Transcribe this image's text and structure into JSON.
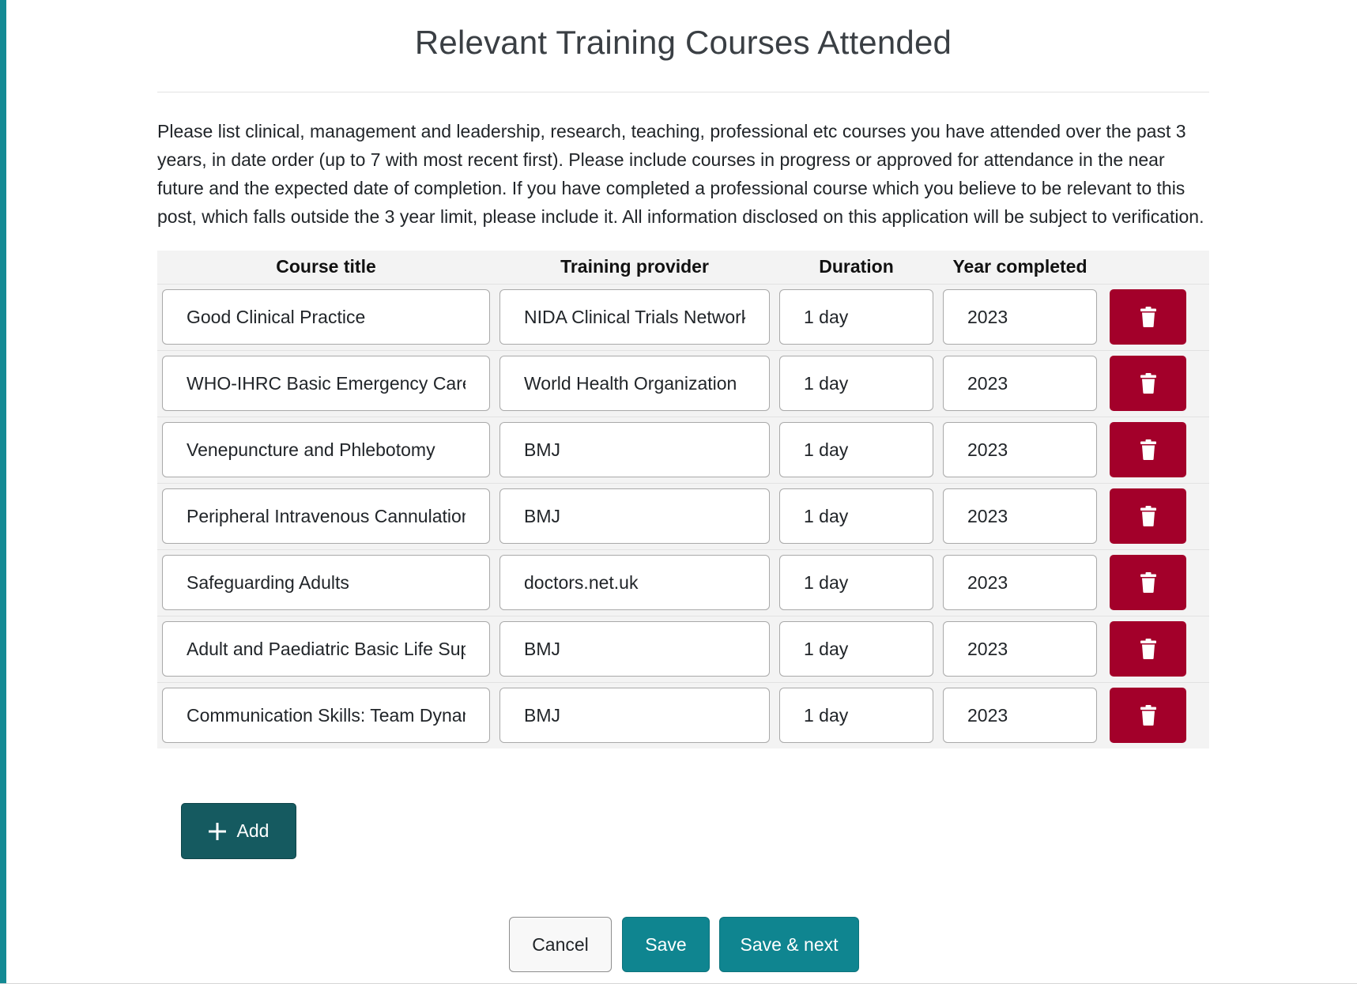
{
  "page": {
    "title": "Relevant Training Courses Attended",
    "intro": "Please list clinical, management and leadership, research, teaching, professional etc courses you have attended over the past 3 years, in date order (up to 7 with most recent first). Please include courses in progress or approved for attendance in the near future and the expected date of completion. If you have completed a professional course which you believe to be relevant to this post, which falls outside the 3 year limit, please include it. All information disclosed on this application will be subject to verification."
  },
  "table": {
    "headers": {
      "course_title": "Course title",
      "training_provider": "Training provider",
      "duration": "Duration",
      "year_completed": "Year completed"
    },
    "rows": [
      {
        "course_title": "Good Clinical Practice",
        "training_provider": "NIDA Clinical Trials Network U",
        "duration": "1 day",
        "year_completed": "2023"
      },
      {
        "course_title": "WHO-IHRC Basic Emergency Care: A",
        "training_provider": "World Health Organization",
        "duration": "1 day",
        "year_completed": "2023"
      },
      {
        "course_title": "Venepuncture and Phlebotomy",
        "training_provider": "BMJ",
        "duration": "1 day",
        "year_completed": "2023"
      },
      {
        "course_title": "Peripheral Intravenous Cannulation",
        "training_provider": "BMJ",
        "duration": "1 day",
        "year_completed": "2023"
      },
      {
        "course_title": "Safeguarding Adults",
        "training_provider": "doctors.net.uk",
        "duration": "1 day",
        "year_completed": "2023"
      },
      {
        "course_title": "Adult and Paediatric Basic Life Supp",
        "training_provider": "BMJ",
        "duration": "1 day",
        "year_completed": "2023"
      },
      {
        "course_title": "Communication Skills: Team Dynam",
        "training_provider": "BMJ",
        "duration": "1 day",
        "year_completed": "2023"
      }
    ],
    "delete_icon": "trash-icon"
  },
  "actions": {
    "add_label": "Add",
    "add_icon": "plus-icon",
    "cancel_label": "Cancel",
    "save_label": "Save",
    "save_next_label": "Save & next"
  },
  "colors": {
    "accent": "#138a94",
    "primary_button": "#0f8590",
    "add_button": "#155a60",
    "delete_button": "#a3002a"
  }
}
